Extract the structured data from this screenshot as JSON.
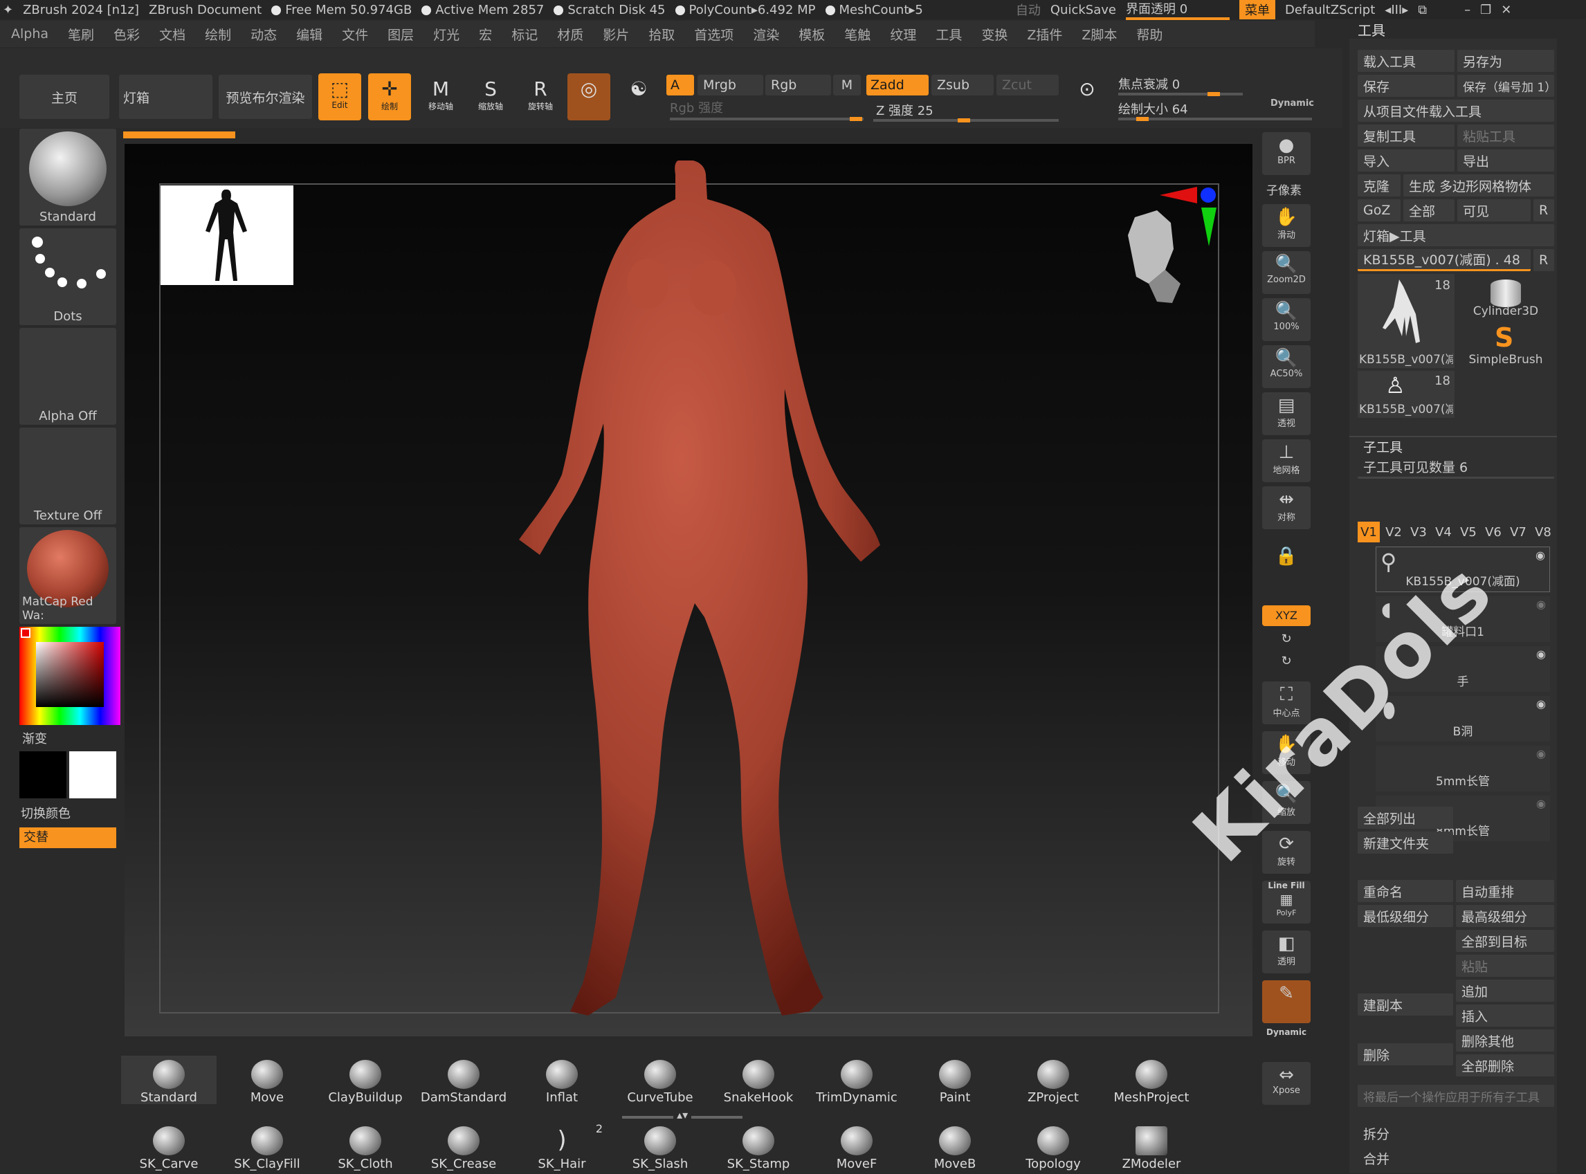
{
  "titlebar": {
    "app": "ZBrush 2024 [n1z]",
    "doc": "ZBrush Document",
    "free_mem": "Free Mem 50.974GB",
    "active_mem": "Active Mem 2857",
    "scratch": "Scratch Disk 45",
    "polycount": "PolyCount▸6.492 MP",
    "meshcount": "MeshCount▸5",
    "auto": "自动",
    "quicksave": "QuickSave",
    "transparency": "界面透明 0",
    "menu": "菜单",
    "script": "DefaultZScript"
  },
  "menubar": [
    "Alpha",
    "笔刷",
    "色彩",
    "文档",
    "绘制",
    "动态",
    "编辑",
    "文件",
    "图层",
    "灯光",
    "宏",
    "标记",
    "材质",
    "影片",
    "拾取",
    "首选项",
    "渲染",
    "模板",
    "笔触",
    "纹理",
    "工具",
    "变换",
    "Z插件",
    "Z脚本",
    "帮助"
  ],
  "shelf": {
    "home": "主页",
    "lightbox": "灯箱",
    "preview": "预览布尔渲染",
    "edit": "Edit",
    "draw": "绘制",
    "move": "移动轴",
    "scale": "缩放轴",
    "rotate": "旋转轴",
    "a": "A",
    "mrgb": "Mrgb",
    "rgb": "Rgb",
    "m": "M",
    "rgb_intensity": "Rgb 强度",
    "zadd": "Zadd",
    "zsub": "Zsub",
    "zcut": "Zcut",
    "z_intensity": "Z 强度 25",
    "focal": "焦点衰减 0",
    "draw_size": "绘制大小 64",
    "dynamic": "Dynamic"
  },
  "leftshelf": {
    "brush": "Standard",
    "stroke": "Dots",
    "alpha": "Alpha Off",
    "texture": "Texture Off",
    "material": "MatCap Red Wa:",
    "gradient": "渐变",
    "switch_color": "切换颜色",
    "alternate": "交替"
  },
  "rightcol": [
    "BPR",
    "子像素",
    "滑动",
    "Zoom2D",
    "100%",
    "AC50%",
    "透视",
    "地网格",
    "对称",
    "XYZ",
    "中心点",
    "移动",
    "缩放",
    "旋转",
    "Line Fill",
    "PolyF",
    "透明",
    "Dynamic",
    "Xpose"
  ],
  "palette": {
    "title": "工具",
    "load": "载入工具",
    "save_as": "另存为",
    "save": "保存",
    "save_inc": "保存（编号加 1）",
    "load_project": "从项目文件载入工具",
    "copy": "复制工具",
    "paste": "粘贴工具",
    "import": "导入",
    "export": "导出",
    "clone": "克隆",
    "make_poly": "生成 多边形网格物体",
    "goz": "GoZ",
    "all": "全部",
    "visible": "可见",
    "r": "R",
    "lightbox_tool": "灯箱▶工具",
    "current_tool": "KB155B_v007(减面) . 48",
    "thumb1": "KB155B_v007(减",
    "thumb1_count": "18",
    "thumb2": "Cylinder3D",
    "thumb3": "SimpleBrush",
    "thumb4": "KB155B_v007(减",
    "thumb4_count": "18",
    "subtool_header": "子工具",
    "subtool_count": "子工具可见数量 6",
    "vtabs": [
      "V1",
      "V2",
      "V3",
      "V4",
      "V5",
      "V6",
      "V7",
      "V8"
    ],
    "subtools": [
      "KB155B_v007(减面)",
      "罐料口1",
      "手",
      "B洞",
      "5mm长管",
      "8mm长管"
    ],
    "list_all": "全部列出",
    "new_folder": "新建文件夹",
    "rename": "重命名",
    "auto_sort": "自动重排",
    "lowest_sub": "最低级细分",
    "highest_sub": "最高级细分",
    "all_to_target": "全部到目标",
    "paste2": "粘贴",
    "append": "追加",
    "dup": "建副本",
    "insert": "插入",
    "delete_other": "删除其他",
    "delete": "删除",
    "delete_all": "全部删除",
    "apply_all": "将最后一个操作应用于所有子工具",
    "split": "拆分",
    "merge": "合并"
  },
  "brushes_row1": [
    "Standard",
    "Move",
    "ClayBuildup",
    "DamStandard",
    "Inflat",
    "CurveTube",
    "SnakeHook",
    "TrimDynamic",
    "Paint",
    "ZProject",
    "MeshProject"
  ],
  "brushes_row2": [
    "SK_Carve",
    "SK_ClayFill",
    "SK_Cloth",
    "SK_Crease",
    "SK_Hair",
    "SK_Slash",
    "SK_Stamp",
    "MoveF",
    "MoveB",
    "Topology",
    "ZModeler"
  ],
  "brush_hair_count": "2",
  "watermark": "KiraDols",
  "colors": {
    "accent": "#f7931e",
    "skin": "#a3402e"
  }
}
